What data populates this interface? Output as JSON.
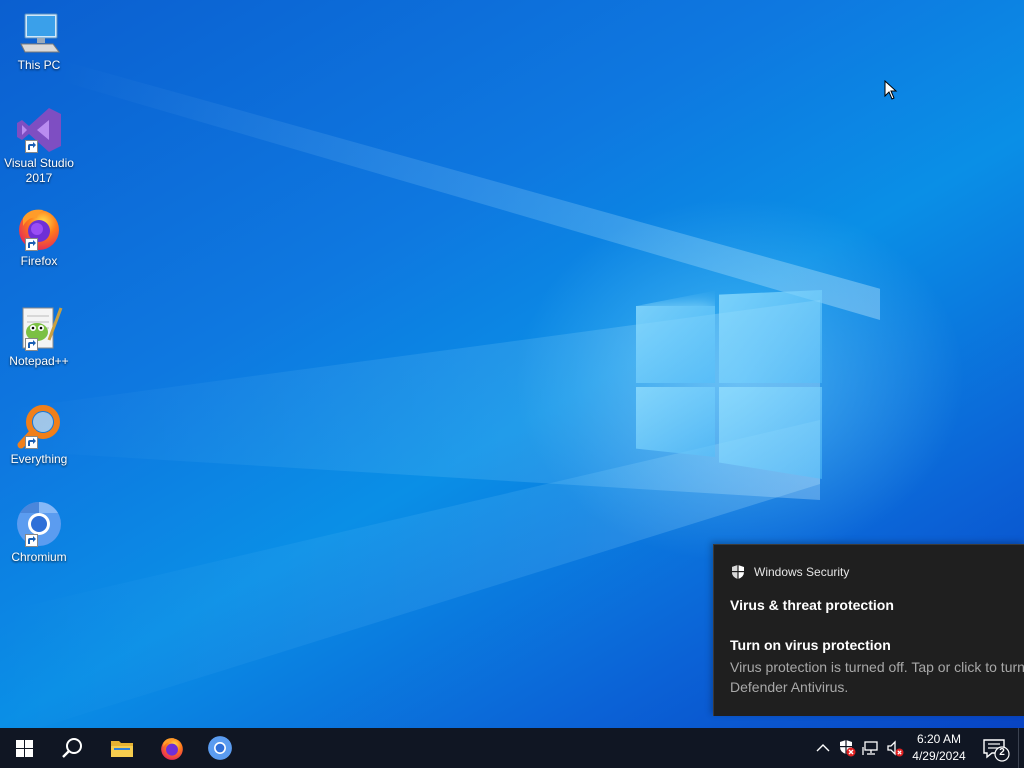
{
  "desktop": {
    "icons": [
      {
        "label": "This PC",
        "icon": "computer-icon",
        "shortcut": false
      },
      {
        "label": "Visual Studio 2017",
        "icon": "visual-studio-icon",
        "shortcut": true
      },
      {
        "label": "Firefox",
        "icon": "firefox-icon",
        "shortcut": true
      },
      {
        "label": "Notepad++",
        "icon": "notepadpp-icon",
        "shortcut": true
      },
      {
        "label": "Everything",
        "icon": "everything-search-icon",
        "shortcut": true
      },
      {
        "label": "Chromium",
        "icon": "chromium-icon",
        "shortcut": true
      }
    ]
  },
  "toast": {
    "app_name": "Windows Security",
    "title": "Virus & threat protection",
    "subtitle": "Turn on virus protection",
    "body": "Virus protection is turned off. Tap or click to turn on Microsoft Defender Antivirus."
  },
  "taskbar": {
    "pinned": [
      {
        "name": "start",
        "icon": "windows-start-icon"
      },
      {
        "name": "search",
        "icon": "search-icon"
      },
      {
        "name": "file-explorer",
        "icon": "folder-icon"
      },
      {
        "name": "firefox",
        "icon": "firefox-icon"
      },
      {
        "name": "chromium",
        "icon": "chromium-icon"
      }
    ],
    "tray": {
      "time": "6:20 AM",
      "date": "4/29/2024",
      "notification_count": "2",
      "icons": [
        "chevron-up-icon",
        "windows-security-warning-icon",
        "network-icon",
        "volume-muted-icon"
      ]
    }
  },
  "colors": {
    "taskbar_bg": "#101623",
    "toast_bg": "#1f1f1f",
    "accent_blue": "#0a78e0"
  }
}
